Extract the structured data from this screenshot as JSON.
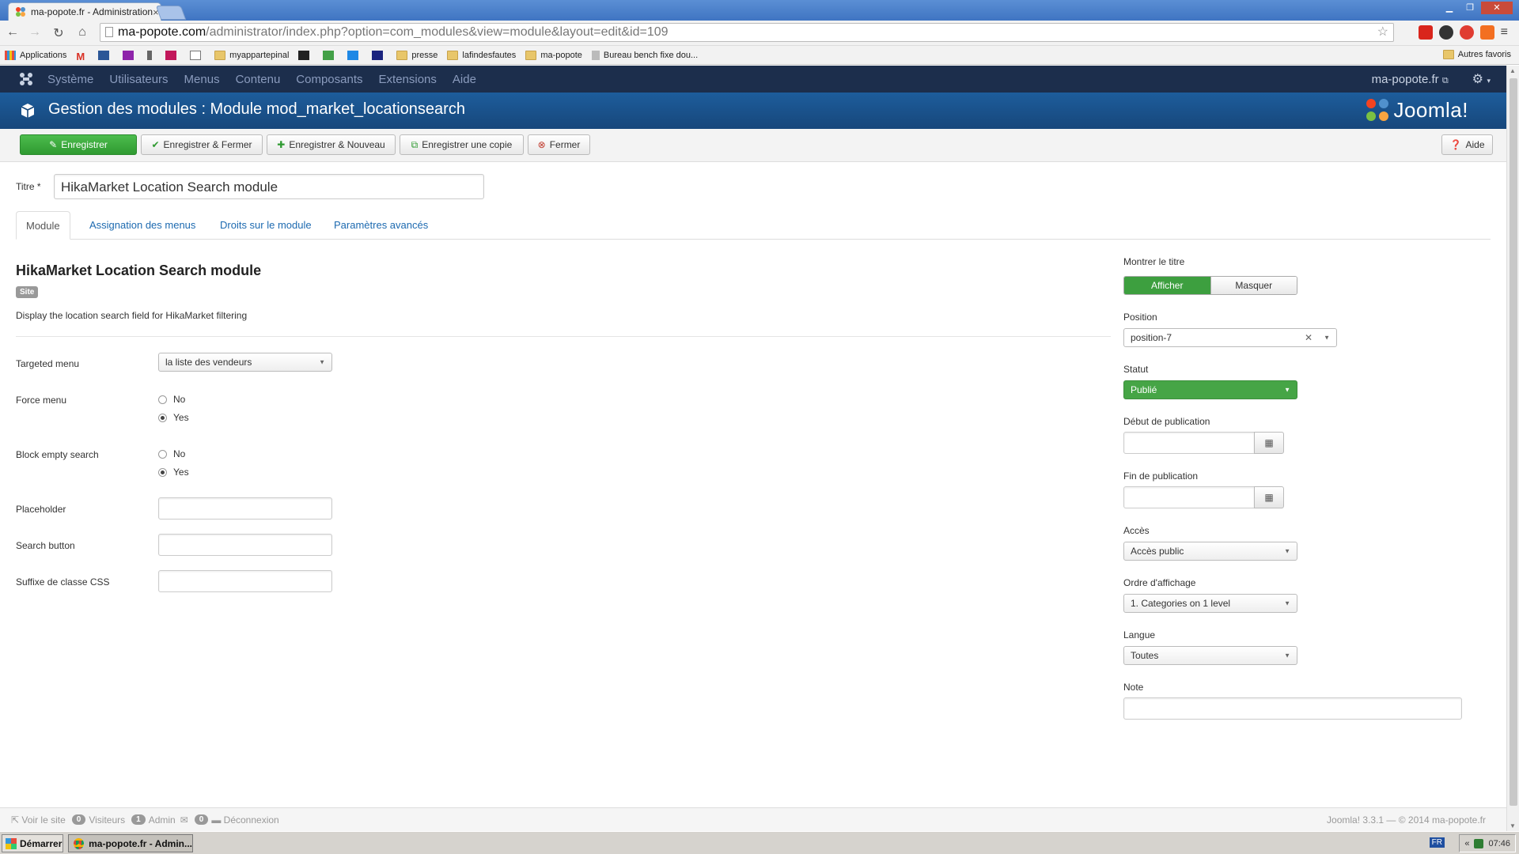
{
  "browser": {
    "tab_title": "ma-popote.fr - Administration",
    "url_host": "ma-popote.com",
    "url_path": "/administrator/index.php?option=com_modules&view=module&layout=edit&id=109",
    "bookmarks": [
      {
        "label": "Applications",
        "icon": "apps-grid-icon"
      },
      {
        "label": "",
        "icon": "gmail-icon"
      },
      {
        "label": "",
        "icon": "bookmark-icon"
      },
      {
        "label": "",
        "icon": "bookmark-icon"
      },
      {
        "label": "",
        "icon": "bookmark-icon"
      },
      {
        "label": "",
        "icon": "bookmark-icon"
      },
      {
        "label": "",
        "icon": "mail-icon"
      },
      {
        "label": "myappartepinal",
        "icon": "folder-icon"
      },
      {
        "label": "",
        "icon": "bookmark-icon"
      },
      {
        "label": "",
        "icon": "bookmark-icon"
      },
      {
        "label": "",
        "icon": "bookmark-icon"
      },
      {
        "label": "",
        "icon": "tv-icon"
      },
      {
        "label": "presse",
        "icon": "folder-icon"
      },
      {
        "label": "lafindesfautes",
        "icon": "folder-icon"
      },
      {
        "label": "ma-popote",
        "icon": "folder-icon"
      },
      {
        "label": "Bureau bench fixe dou...",
        "icon": "bookmark-icon"
      }
    ],
    "other_bookmarks": "Autres favoris"
  },
  "jnav": {
    "items": [
      "Système",
      "Utilisateurs",
      "Menus",
      "Contenu",
      "Composants",
      "Extensions",
      "Aide"
    ],
    "site_link": "ma-popote.fr"
  },
  "header": {
    "title": "Gestion des modules : Module mod_market_locationsearch",
    "brand": "Joomla!"
  },
  "toolbar": {
    "save": "Enregistrer",
    "save_close": "Enregistrer & Fermer",
    "save_new": "Enregistrer & Nouveau",
    "save_copy": "Enregistrer une copie",
    "close": "Fermer",
    "help": "Aide"
  },
  "form": {
    "title_label": "Titre *",
    "title_value": "HikaMarket Location Search module",
    "tabs": [
      "Module",
      "Assignation des menus",
      "Droits sur le module",
      "Paramètres avancés"
    ],
    "module_title": "HikaMarket Location Search module",
    "badge": "Site",
    "description": "Display the location search field for HikaMarket filtering",
    "targeted_menu_label": "Targeted menu",
    "targeted_menu_value": "la liste des vendeurs",
    "force_menu_label": "Force menu",
    "block_empty_label": "Block empty search",
    "opt_no": "No",
    "opt_yes": "Yes",
    "placeholder_label": "Placeholder",
    "search_button_label": "Search button",
    "css_suffix_label": "Suffixe de classe CSS"
  },
  "side": {
    "show_title_label": "Montrer le titre",
    "show": "Afficher",
    "hide": "Masquer",
    "position_label": "Position",
    "position_value": "position-7",
    "status_label": "Statut",
    "status_value": "Publié",
    "start_label": "Début de publication",
    "end_label": "Fin de publication",
    "access_label": "Accès",
    "access_value": "Accès public",
    "order_label": "Ordre d'affichage",
    "order_value": "1. Categories on 1 level",
    "lang_label": "Langue",
    "lang_value": "Toutes",
    "note_label": "Note"
  },
  "status": {
    "view_site": "Voir le site",
    "visitors_count": "0",
    "visitors": "Visiteurs",
    "admin_count": "1",
    "admin": "Admin",
    "msg_count": "0",
    "logout": "Déconnexion",
    "version": "Joomla! 3.3.1 — © 2014 ma-popote.fr"
  },
  "taskbar": {
    "start": "Démarrer",
    "task": "ma-popote.fr - Admin...",
    "lang": "FR",
    "clock": "07:46"
  },
  "colors": {
    "joomla_nav": "#1c2e4c",
    "header_blue": "#17477b",
    "success_green": "#3d9f3f",
    "link_blue": "#1d6ab0"
  }
}
